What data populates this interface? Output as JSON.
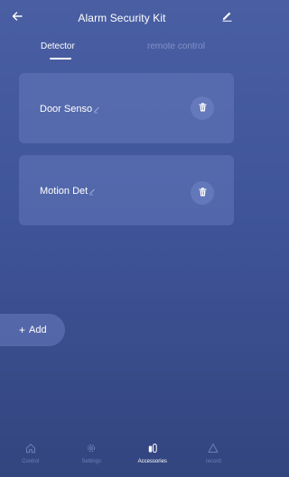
{
  "header": {
    "title": "Alarm Security Kit",
    "back_icon": "arrow-left-icon",
    "edit_icon": "pencil-icon"
  },
  "tabs": [
    {
      "label": "Detector",
      "active": true
    },
    {
      "label": "remote control",
      "active": false
    }
  ],
  "devices": [
    {
      "name": "Door Senso",
      "edit_icon": "pencil-icon",
      "delete_icon": "trash-icon"
    },
    {
      "name": "Motion Det",
      "edit_icon": "pencil-icon",
      "delete_icon": "trash-icon"
    }
  ],
  "add_button": {
    "label": "Add",
    "icon": "plus-icon"
  },
  "nav": [
    {
      "label": "Control",
      "icon": "home-icon",
      "active": false
    },
    {
      "label": "Settings",
      "icon": "gear-icon",
      "active": false
    },
    {
      "label": "Accessories",
      "icon": "accessories-icon",
      "active": true
    },
    {
      "label": "record",
      "icon": "warning-icon",
      "active": false
    }
  ],
  "colors": {
    "background_top": "#4a5fa3",
    "background_bottom": "#33457f",
    "inactive_text": "#8391c6",
    "nav_inactive": "#6f7eb6"
  }
}
